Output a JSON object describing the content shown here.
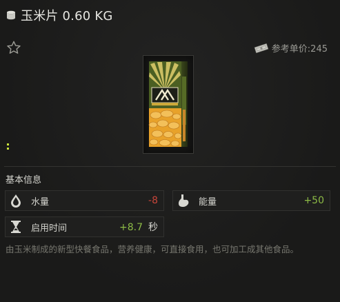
{
  "header": {
    "title": "玉米片 0.60 KG",
    "weight_icon": "weight-icon"
  },
  "favorite": {
    "icon": "star-outline-icon"
  },
  "price": {
    "label": "参考单价:245",
    "icon": "money-icon"
  },
  "item": {
    "icon": "cereal-box-image"
  },
  "info": {
    "section_title": "基本信息",
    "stats": {
      "water": {
        "label": "水量",
        "value": "-8",
        "icon": "water-drop-icon",
        "color": "#c8453a"
      },
      "energy": {
        "label": "能量",
        "value": "+50",
        "icon": "stomach-icon",
        "color": "#8dbb46"
      },
      "use_time": {
        "label": "启用时间",
        "value": "+8.7",
        "unit": "秒",
        "icon": "hourglass-icon",
        "color": "#8dbb46"
      }
    }
  },
  "description": "由玉米制成的新型快餐食品，营养健康，可直接食用，也可加工成其他食品。"
}
